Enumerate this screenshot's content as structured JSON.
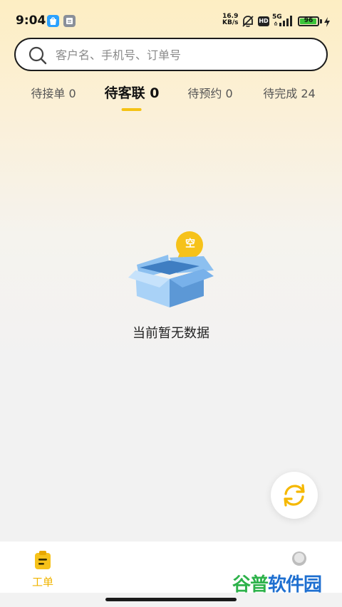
{
  "status_bar": {
    "time": "9:04",
    "net_speed_value": "16.9",
    "net_speed_unit": "KB/s",
    "hd_badge": "HD",
    "signal_label": "5G",
    "battery_level": "96",
    "battery_fraction": 0.96
  },
  "search": {
    "placeholder": "客户名、手机号、订单号",
    "value": ""
  },
  "tabs": [
    {
      "label": "待接单 0",
      "active": false
    },
    {
      "label": "待客联 0",
      "active": true
    },
    {
      "label": "待预约 0",
      "active": false
    },
    {
      "label": "待完成 24",
      "active": false
    }
  ],
  "empty_state": {
    "badge": "空",
    "message": "当前暂无数据"
  },
  "bottom_nav": {
    "items": [
      {
        "label": "工单",
        "icon": "clipboard-icon",
        "active": true
      },
      {
        "label": "",
        "icon": "profile-icon",
        "active": false
      }
    ]
  },
  "watermark": {
    "text_part1": "谷普",
    "text_part2": "软件园"
  },
  "colors": {
    "accent": "#f5c213",
    "accent_text": "#f0b400",
    "box_light": "#a9d2f7",
    "box_dark": "#5c98d6",
    "battery_green": "#3ac43a"
  }
}
